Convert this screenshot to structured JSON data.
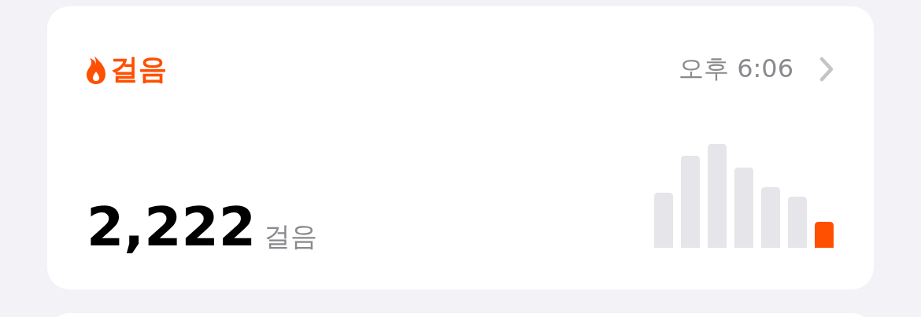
{
  "card": {
    "title": "걸음",
    "time": "오후 6:06",
    "value": "2,222",
    "unit": "걸음"
  }
}
